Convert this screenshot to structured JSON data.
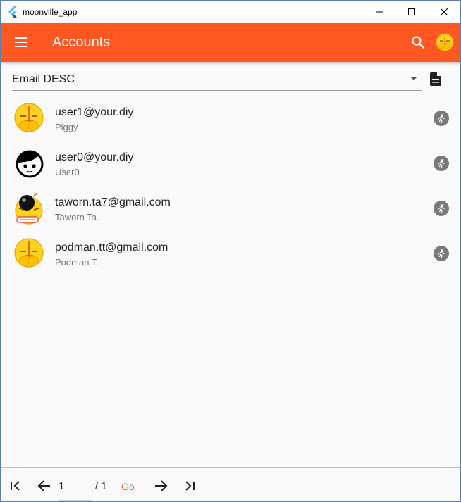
{
  "window": {
    "title": "moonville_app"
  },
  "appbar": {
    "title": "Accounts"
  },
  "sort": {
    "selected": "Email DESC"
  },
  "accounts": [
    {
      "email": "user1@your.diy",
      "name": "Piggy",
      "avatar": "smiley-emoji-avatar"
    },
    {
      "email": "user0@your.diy",
      "name": "User0",
      "avatar": "face-avatar"
    },
    {
      "email": "taworn.ta7@gmail.com",
      "name": "Taworn Ta.",
      "avatar": "bomb-emoji-avatar"
    },
    {
      "email": "podman.tt@gmail.com",
      "name": "Podman T.",
      "avatar": "smiley-emoji-avatar"
    }
  ],
  "pager": {
    "page_value": "1",
    "total": "/ 1",
    "go_label": "Go"
  },
  "colors": {
    "accent": "#ff5722",
    "action_icon_bg": "#7a7a7a"
  }
}
